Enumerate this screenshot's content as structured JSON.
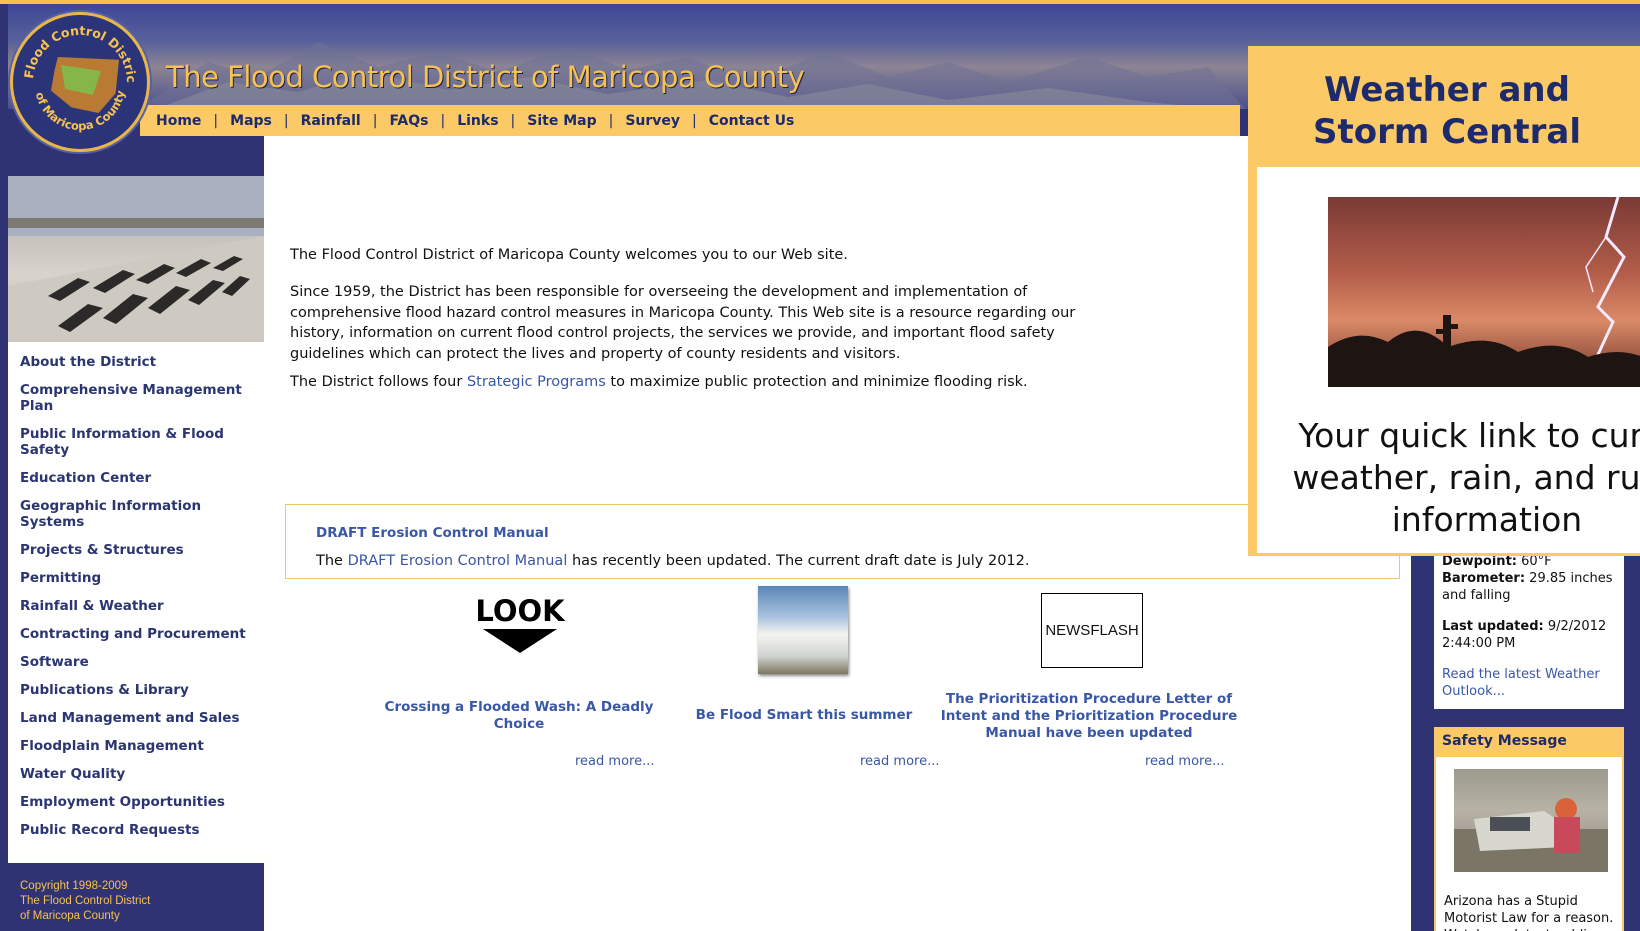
{
  "site": {
    "title": "The Flood Control District of Maricopa County",
    "logo_text_top": "Flood Control District",
    "logo_text_bottom": "of Maricopa County"
  },
  "nav": {
    "items": [
      "Home",
      "Maps",
      "Rainfall",
      "FAQs",
      "Links",
      "Site Map",
      "Survey",
      "Contact Us"
    ],
    "separator": "|"
  },
  "sidebar": {
    "items": [
      "About the District",
      "Comprehensive Management Plan",
      "Public Information & Flood Safety",
      "Education Center",
      "Geographic Information Systems",
      "Projects & Structures",
      "Permitting",
      "Rainfall & Weather",
      "Contracting and Procurement",
      "Software",
      "Publications & Library",
      "Land Management and Sales",
      "Floodplain Management",
      "Water Quality",
      "Employment Opportunities",
      "Public Record Requests"
    ],
    "copyright_lines": [
      "Copyright 1998-2009",
      "The Flood Control District",
      "of Maricopa County"
    ]
  },
  "main": {
    "welcome": "The Flood Control District of Maricopa County welcomes you to our Web site.",
    "history": "Since 1959, the District has been responsible for overseeing the development and implementation of comprehensive flood hazard control measures in Maricopa County. This Web site is a resource regarding our history, information on current flood control projects, the services we provide, and important flood safety guidelines which can protect the lives and property of county residents and visitors.",
    "programs_before": "The District follows four ",
    "programs_link": "Strategic Programs",
    "programs_after": " to maximize public protection and minimize flooding risk.",
    "draft": {
      "title": "DRAFT Erosion Control Manual",
      "text_before": "The ",
      "link": "DRAFT Erosion Control Manual",
      "text_after": " has recently been updated. The current draft date is July 2012."
    },
    "features": [
      {
        "image_label": "LOOK",
        "title": "Crossing a Flooded Wash: A Deadly Choice",
        "more": "read more..."
      },
      {
        "image_label": "",
        "title": "Be Flood Smart this summer",
        "more": "read more..."
      },
      {
        "image_label": "NEWSFLASH",
        "title": "The Prioritization Procedure Letter of Intent and the Prioritization Procedure Manual have been updated",
        "more": "read more..."
      }
    ]
  },
  "weather": {
    "dewpoint_label": "Dewpoint:",
    "dewpoint_value": "60°F",
    "barometer_label": "Barometer:",
    "barometer_value": "29.85 inches and falling",
    "updated_label": "Last updated:",
    "updated_value": "9/2/2012 2:44:00 PM",
    "outlook_link": "Read the latest Weather Outlook..."
  },
  "safety": {
    "heading": "Safety Message",
    "text": "Arizona has a Stupid Motorist Law for a reason. Watch our latest public"
  },
  "popup": {
    "title_line1": "Weather and",
    "title_line2": "Storm Central",
    "caption_line1": "Your quick link to curre",
    "caption_line2": "weather, rain, and runo",
    "caption_line3": "information"
  },
  "colors": {
    "navy": "#2f3374",
    "gold": "#fbca66",
    "link_blue": "#3a57a6",
    "nav_text": "#1d2a6b"
  }
}
